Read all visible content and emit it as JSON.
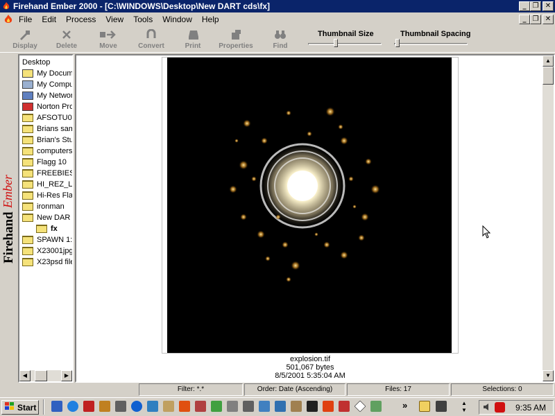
{
  "window": {
    "title": "Firehand Ember 2000 - [C:\\WINDOWS\\Desktop\\New DART cds\\fx]",
    "caption_buttons": [
      "_",
      "❐",
      "✕"
    ],
    "mdi_buttons": [
      "_",
      "❐",
      "✕"
    ]
  },
  "menu": [
    "File",
    "Edit",
    "Process",
    "View",
    "Tools",
    "Window",
    "Help"
  ],
  "toolbar": {
    "buttons": [
      "Display",
      "Delete",
      "Move",
      "Convert",
      "Print",
      "Properties",
      "Find"
    ],
    "thumbnail_size_label": "Thumbnail Size",
    "thumbnail_spacing_label": "Thumbnail Spacing",
    "thumbnail_size_level": 0.37,
    "thumbnail_spacing_level": 0.0
  },
  "brand": {
    "first": "Firehand",
    "second": "Ember"
  },
  "tree": {
    "items": [
      {
        "label": "Desktop",
        "icon": "desktop-icon",
        "indent": 0
      },
      {
        "label": "My Docum",
        "icon": "my-documents-icon",
        "indent": 1
      },
      {
        "label": "My Compu",
        "icon": "my-computer-icon",
        "indent": 1
      },
      {
        "label": "My Networ",
        "icon": "network-icon",
        "indent": 1
      },
      {
        "label": "Norton Pro",
        "icon": "norton-icon",
        "indent": 1
      },
      {
        "label": "AFSOTU0",
        "icon": "folder-icon",
        "indent": 1
      },
      {
        "label": "Brians sam",
        "icon": "folder-icon",
        "indent": 1
      },
      {
        "label": "Brian's Stu",
        "icon": "folder-icon",
        "indent": 1
      },
      {
        "label": "computers",
        "icon": "folder-icon",
        "indent": 1
      },
      {
        "label": "Flagg 10",
        "icon": "folder-icon",
        "indent": 1
      },
      {
        "label": "FREEBIES",
        "icon": "folder-icon",
        "indent": 1
      },
      {
        "label": "HI_REZ_L",
        "icon": "folder-icon",
        "indent": 1
      },
      {
        "label": "Hi-Res Fla",
        "icon": "folder-icon",
        "indent": 1
      },
      {
        "label": "ironman",
        "icon": "folder-icon",
        "indent": 1
      },
      {
        "label": "New DAR",
        "icon": "folder-icon",
        "indent": 1
      },
      {
        "label": "fx",
        "icon": "open-folder-icon",
        "indent": 2
      },
      {
        "label": "SPAWN 1:",
        "icon": "folder-icon",
        "indent": 1
      },
      {
        "label": "X23001jpg",
        "icon": "folder-icon",
        "indent": 1
      },
      {
        "label": "X23psd file",
        "icon": "folder-icon",
        "indent": 1
      }
    ]
  },
  "thumbnail": {
    "filename": "explosion.tif",
    "size": "501,067 bytes",
    "date": "8/5/2001 5:35:04 AM"
  },
  "status": {
    "filter": "Filter: *.*",
    "order": "Order: Date (Ascending)",
    "files": "Files: 17",
    "selections": "Selections: 0"
  },
  "taskbar": {
    "start_label": "Start",
    "clock": "9:35 AM",
    "overflow": "»"
  },
  "colors": {
    "titlebar": "#0a246a",
    "face": "#d4d0c8",
    "folder": "#f5e27a"
  }
}
